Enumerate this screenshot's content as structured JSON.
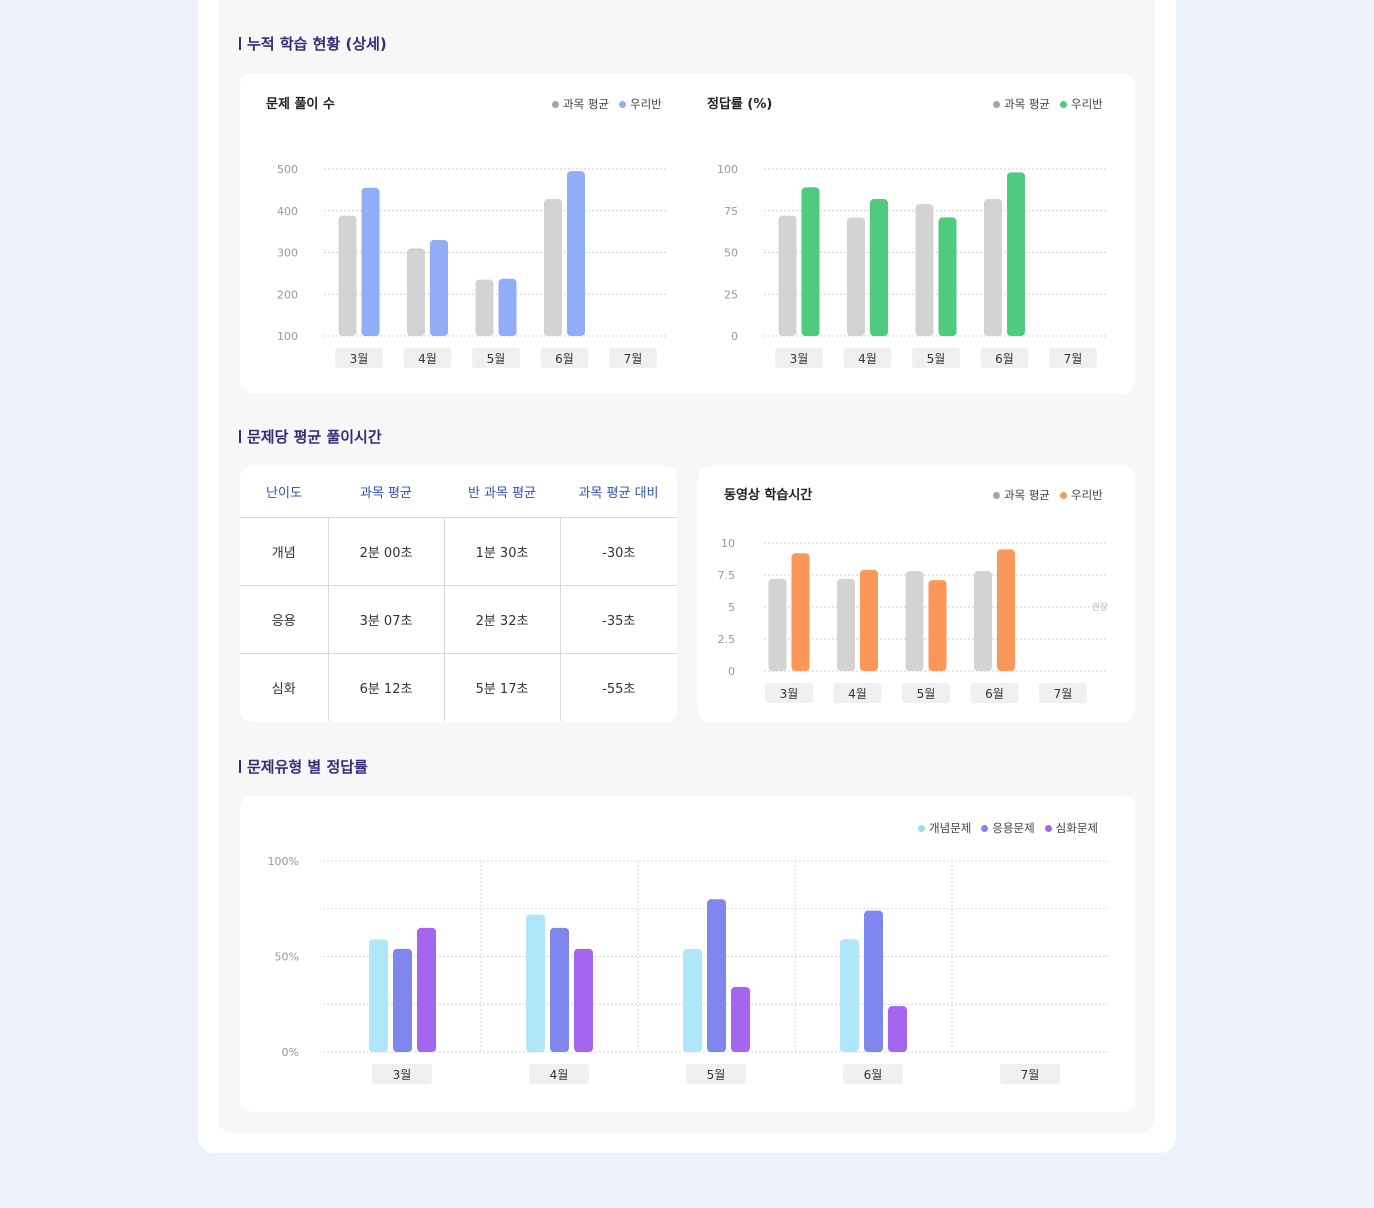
{
  "sections": {
    "cumulative_title": "누적 학습 현황 (상세)",
    "avg_time_title": "문제당 평균 풀이시간",
    "type_rate_title": "문제유형 별 정답률"
  },
  "colors": {
    "gray": "#d3d3d3",
    "blue": "#91adf7",
    "green": "#4ecb7e",
    "orange": "#fd9659",
    "cyan": "#b0e6f9",
    "indigo": "#7f86ee",
    "violet": "#a466ee"
  },
  "chart_data": [
    {
      "type": "bar",
      "title": "문제 풀이 수",
      "categories": [
        "3월",
        "4월",
        "5월",
        "6월",
        "7월"
      ],
      "series": [
        {
          "name": "과목 평균",
          "values": [
            388,
            310,
            235,
            428,
            null
          ]
        },
        {
          "name": "우리반",
          "values": [
            455,
            330,
            237,
            495,
            null
          ]
        }
      ],
      "yticks": [
        "500",
        "400",
        "300",
        "200",
        "100"
      ],
      "ylim": [
        100,
        500
      ]
    },
    {
      "type": "bar",
      "title": "정답률 (%)",
      "categories": [
        "3월",
        "4월",
        "5월",
        "6월",
        "7월"
      ],
      "series": [
        {
          "name": "과목 평균",
          "values": [
            72,
            71,
            79,
            82,
            null
          ]
        },
        {
          "name": "우리반",
          "values": [
            89,
            82,
            71,
            98,
            null
          ]
        }
      ],
      "yticks": [
        "100",
        "75",
        "50",
        "25",
        "0"
      ],
      "ylim": [
        0,
        100
      ]
    },
    {
      "type": "bar",
      "title": "동영상 학습시간",
      "categories": [
        "3월",
        "4월",
        "5월",
        "6월",
        "7월"
      ],
      "series": [
        {
          "name": "과목 평균",
          "values": [
            7.2,
            7.2,
            7.8,
            7.8,
            null
          ]
        },
        {
          "name": "우리반",
          "values": [
            9.2,
            7.9,
            7.1,
            9.5,
            null
          ]
        }
      ],
      "yticks": [
        "10",
        "7.5",
        "5",
        "2.5",
        "0"
      ],
      "ylim": [
        0,
        10
      ],
      "reference_line": {
        "value": 5,
        "label": "권장"
      }
    },
    {
      "type": "bar",
      "title": "",
      "categories": [
        "3월",
        "4월",
        "5월",
        "6월",
        "7월"
      ],
      "series": [
        {
          "name": "개념문제",
          "values": [
            59,
            72,
            54,
            59,
            null
          ]
        },
        {
          "name": "응용문제",
          "values": [
            54,
            65,
            80,
            74,
            null
          ]
        },
        {
          "name": "심화문제",
          "values": [
            65,
            54,
            34,
            24,
            null
          ]
        }
      ],
      "yticks": [
        "100%",
        "50%",
        "0%"
      ],
      "ylim": [
        0,
        100
      ]
    }
  ],
  "difficulty_table": {
    "headers": [
      "난이도",
      "과목 평균",
      "반 과목 평균",
      "과목 평균 대비"
    ],
    "rows": [
      [
        "개념",
        "2분 00초",
        "1분 30초",
        "-30초"
      ],
      [
        "응용",
        "3분 07초",
        "2분 32초",
        "-35초"
      ],
      [
        "심화",
        "6분 12초",
        "5분 17초",
        "-55초"
      ]
    ]
  }
}
